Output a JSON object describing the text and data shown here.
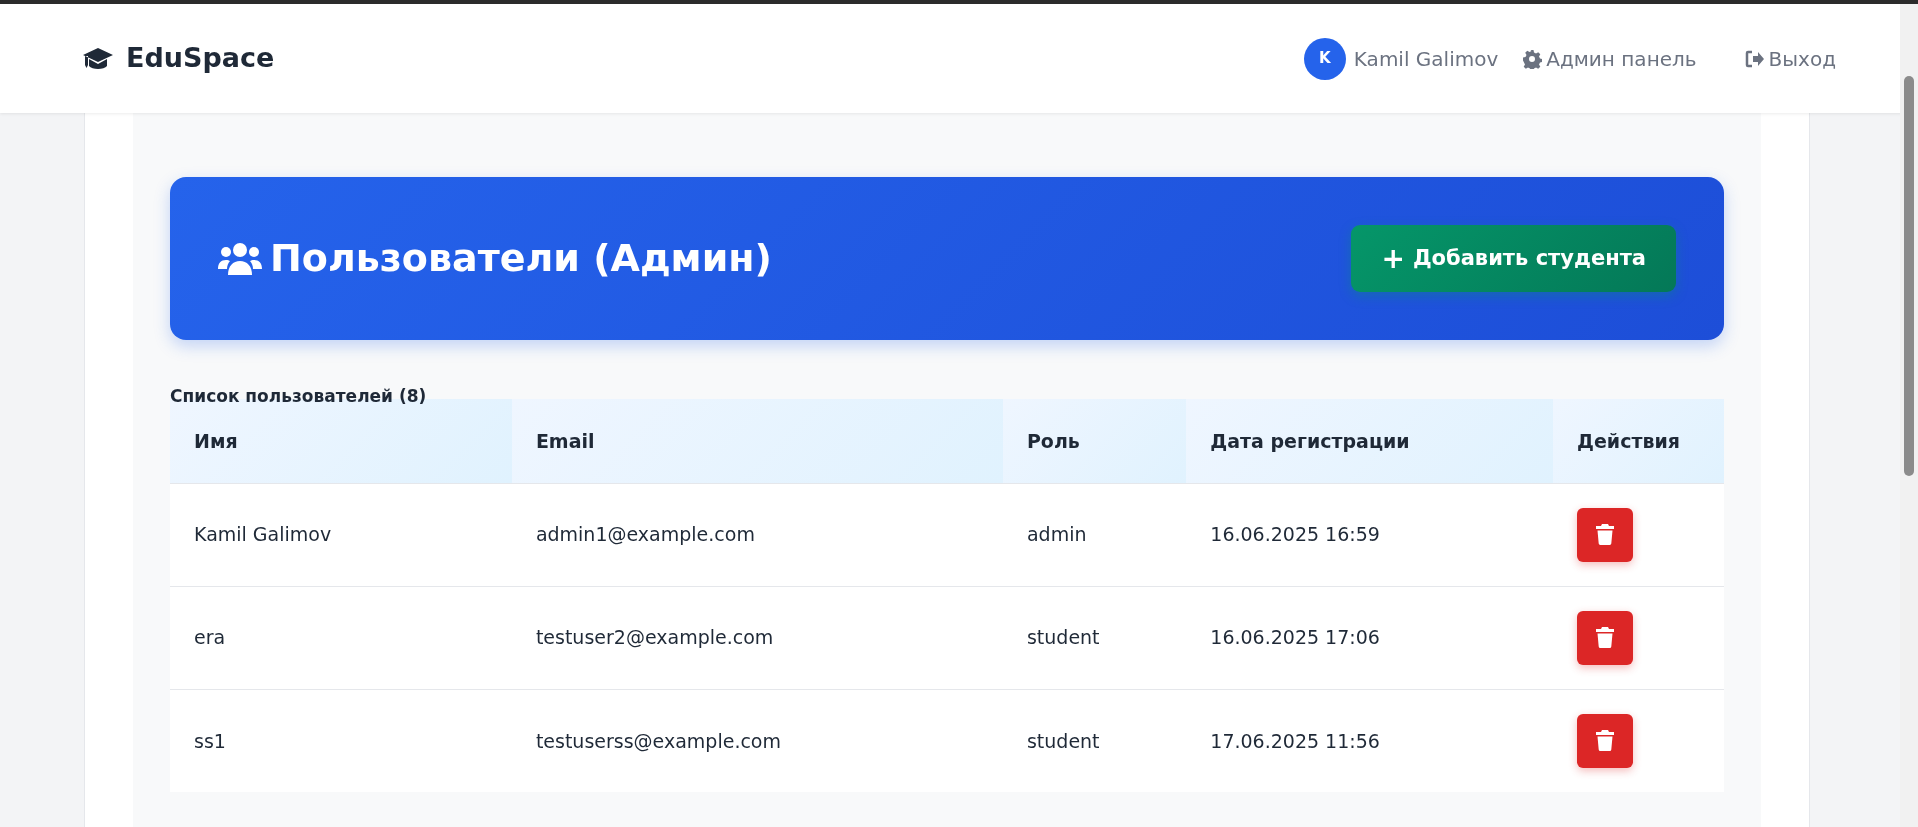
{
  "navbar": {
    "brand": "EduSpace",
    "user": {
      "initial": "K",
      "name": "Kamil Galimov"
    },
    "links": [
      {
        "kind": "settings",
        "label": "Админ панель"
      },
      {
        "kind": "logout",
        "label": "Выход"
      }
    ]
  },
  "banner": {
    "title": "Пользователи (Админ)",
    "button": {
      "icon": "+",
      "label": "Добавить студента"
    }
  },
  "table": {
    "caption": "Список пользователей (8)",
    "columns": [
      "Имя",
      "Email",
      "Роль",
      "Дата регистрации",
      "Действия"
    ],
    "rows": [
      {
        "name": "Kamil Galimov",
        "email": "admin1@example.com",
        "role": "admin",
        "date": "16.06.2025 16:59"
      },
      {
        "name": "era",
        "email": "testuser2@example.com",
        "role": "student",
        "date": "16.06.2025 17:06"
      },
      {
        "name": "ss1",
        "email": "testuserss@example.com",
        "role": "student",
        "date": "17.06.2025 11:56"
      }
    ]
  }
}
